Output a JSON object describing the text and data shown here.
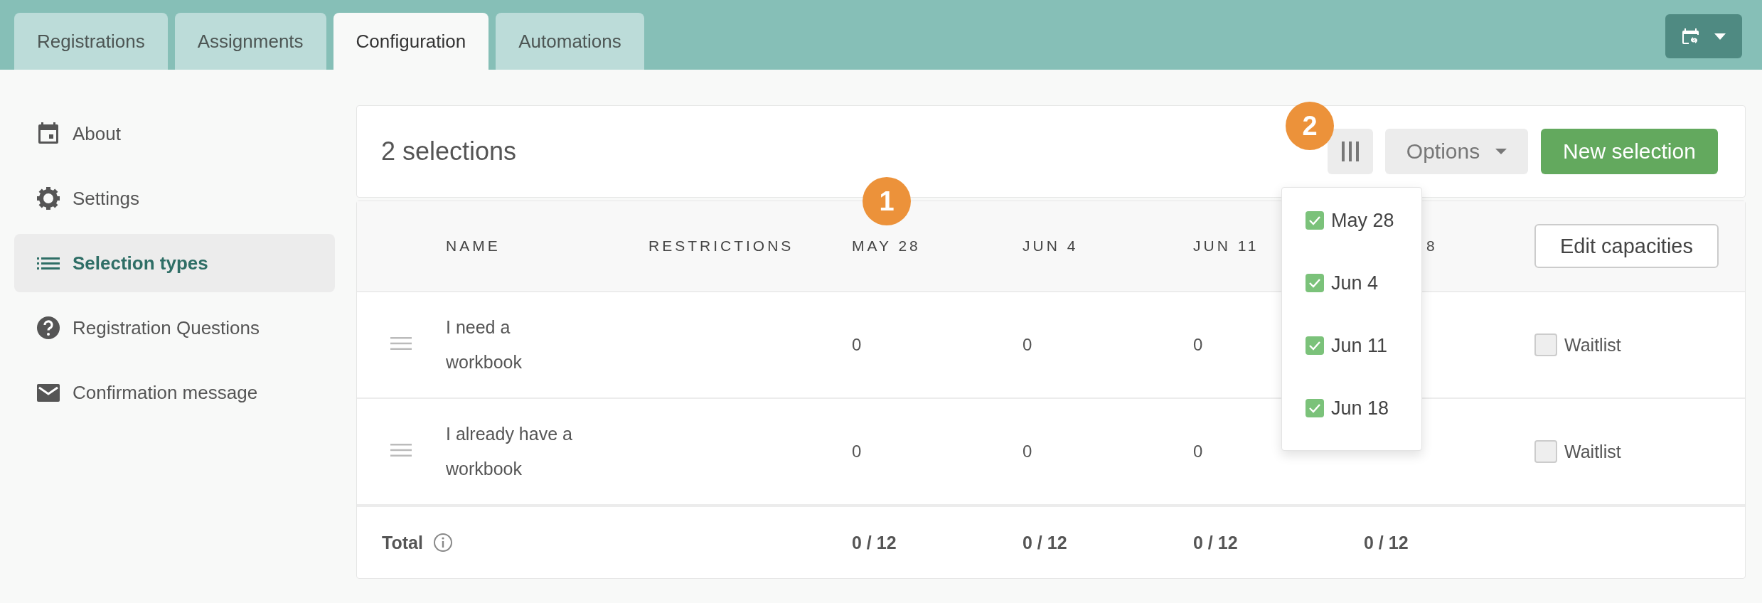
{
  "tabs": [
    {
      "label": "Registrations",
      "selected": false
    },
    {
      "label": "Assignments",
      "selected": false
    },
    {
      "label": "Configuration",
      "selected": true
    },
    {
      "label": "Automations",
      "selected": false
    }
  ],
  "sidebar": {
    "items": [
      {
        "label": "About",
        "selected": false
      },
      {
        "label": "Settings",
        "selected": false
      },
      {
        "label": "Selection types",
        "selected": true
      },
      {
        "label": "Registration Questions",
        "selected": false
      },
      {
        "label": "Confirmation message",
        "selected": false
      }
    ]
  },
  "header": {
    "title": "2 selections",
    "options_label": "Options",
    "new_button": "New selection"
  },
  "badges": [
    "1",
    "2"
  ],
  "table": {
    "columns": [
      "NAME",
      "RESTRICTIONS",
      "MAY 28",
      "JUN 4",
      "JUN 11",
      "8"
    ],
    "action_button": "Edit capacities",
    "rows": [
      {
        "cells": [
          "I need a workbook",
          "",
          "0",
          "0",
          "0"
        ],
        "waitlist": {
          "label": "Waitlist",
          "checked": false
        }
      },
      {
        "cells": [
          "I already have a workbook",
          "",
          "0",
          "0",
          "0"
        ],
        "waitlist": {
          "label": "Waitlist",
          "checked": false
        }
      }
    ],
    "total": {
      "cells": [
        "Total",
        "",
        "0 / 12",
        "0 / 12",
        "0 / 12",
        "0 / 12"
      ]
    }
  },
  "column_menu": {
    "items": [
      {
        "label": "May 28",
        "checked": true
      },
      {
        "label": "Jun 4",
        "checked": true
      },
      {
        "label": "Jun 11",
        "checked": true
      },
      {
        "label": "Jun 18",
        "checked": true
      }
    ]
  }
}
